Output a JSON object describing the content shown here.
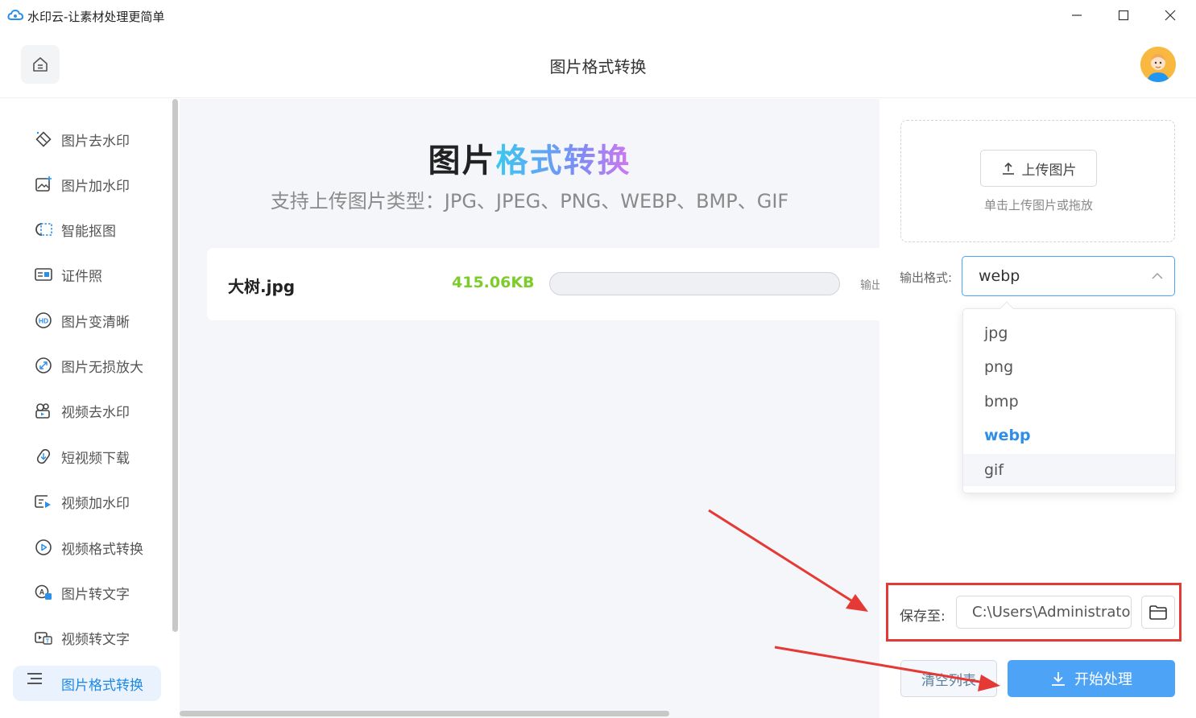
{
  "window": {
    "title": "水印云-让素材处理更简单",
    "controls": [
      "minimize",
      "maximize",
      "close"
    ]
  },
  "header": {
    "title": "图片格式转换",
    "home_icon": "home-icon",
    "avatar_icon": "user-avatar"
  },
  "sidebar": {
    "items": [
      {
        "label": "图片去水印",
        "icon": "eraser-icon"
      },
      {
        "label": "图片加水印",
        "icon": "image-add-icon"
      },
      {
        "label": "智能抠图",
        "icon": "cutout-icon"
      },
      {
        "label": "证件照",
        "icon": "id-card-icon"
      },
      {
        "label": "图片变清晰",
        "icon": "hd-icon"
      },
      {
        "label": "图片无损放大",
        "icon": "enlarge-icon"
      },
      {
        "label": "视频去水印",
        "icon": "video-eraser-icon"
      },
      {
        "label": "短视频下载",
        "icon": "download-link-icon"
      },
      {
        "label": "视频加水印",
        "icon": "video-add-icon"
      },
      {
        "label": "视频格式转换",
        "icon": "video-convert-icon"
      },
      {
        "label": "图片转文字",
        "icon": "image-text-icon"
      },
      {
        "label": "视频转文字",
        "icon": "video-text-icon"
      },
      {
        "label": "图片格式转换",
        "icon": "image-convert-icon",
        "active": true
      }
    ]
  },
  "main": {
    "hero_title_part1": "图片",
    "hero_title_part2": "格式转换",
    "hero_subtitle": "支持上传图片类型：JPG、JPEG、PNG、WEBP、BMP、GIF",
    "file": {
      "name": "大树.jpg",
      "size": "415.06KB",
      "progress": 0,
      "output_label": "输出"
    }
  },
  "right_panel": {
    "upload_button": "上传图片",
    "upload_hint": "单击上传图片或拖放",
    "format_label": "输出格式:",
    "format_value": "webp",
    "format_options": [
      "jpg",
      "png",
      "bmp",
      "webp",
      "gif"
    ],
    "selected_option": "webp",
    "hovered_option": "gif",
    "save_label": "保存至:",
    "save_path": "C:\\Users\\Administrator",
    "clear_button": "清空列表",
    "start_button": "开始处理"
  },
  "colors": {
    "accent": "#4da3f5",
    "selected_text": "#2f8fe8",
    "file_size": "#7ccc2a",
    "annotation_red": "#e53935",
    "main_bg": "#f4f6fa"
  }
}
